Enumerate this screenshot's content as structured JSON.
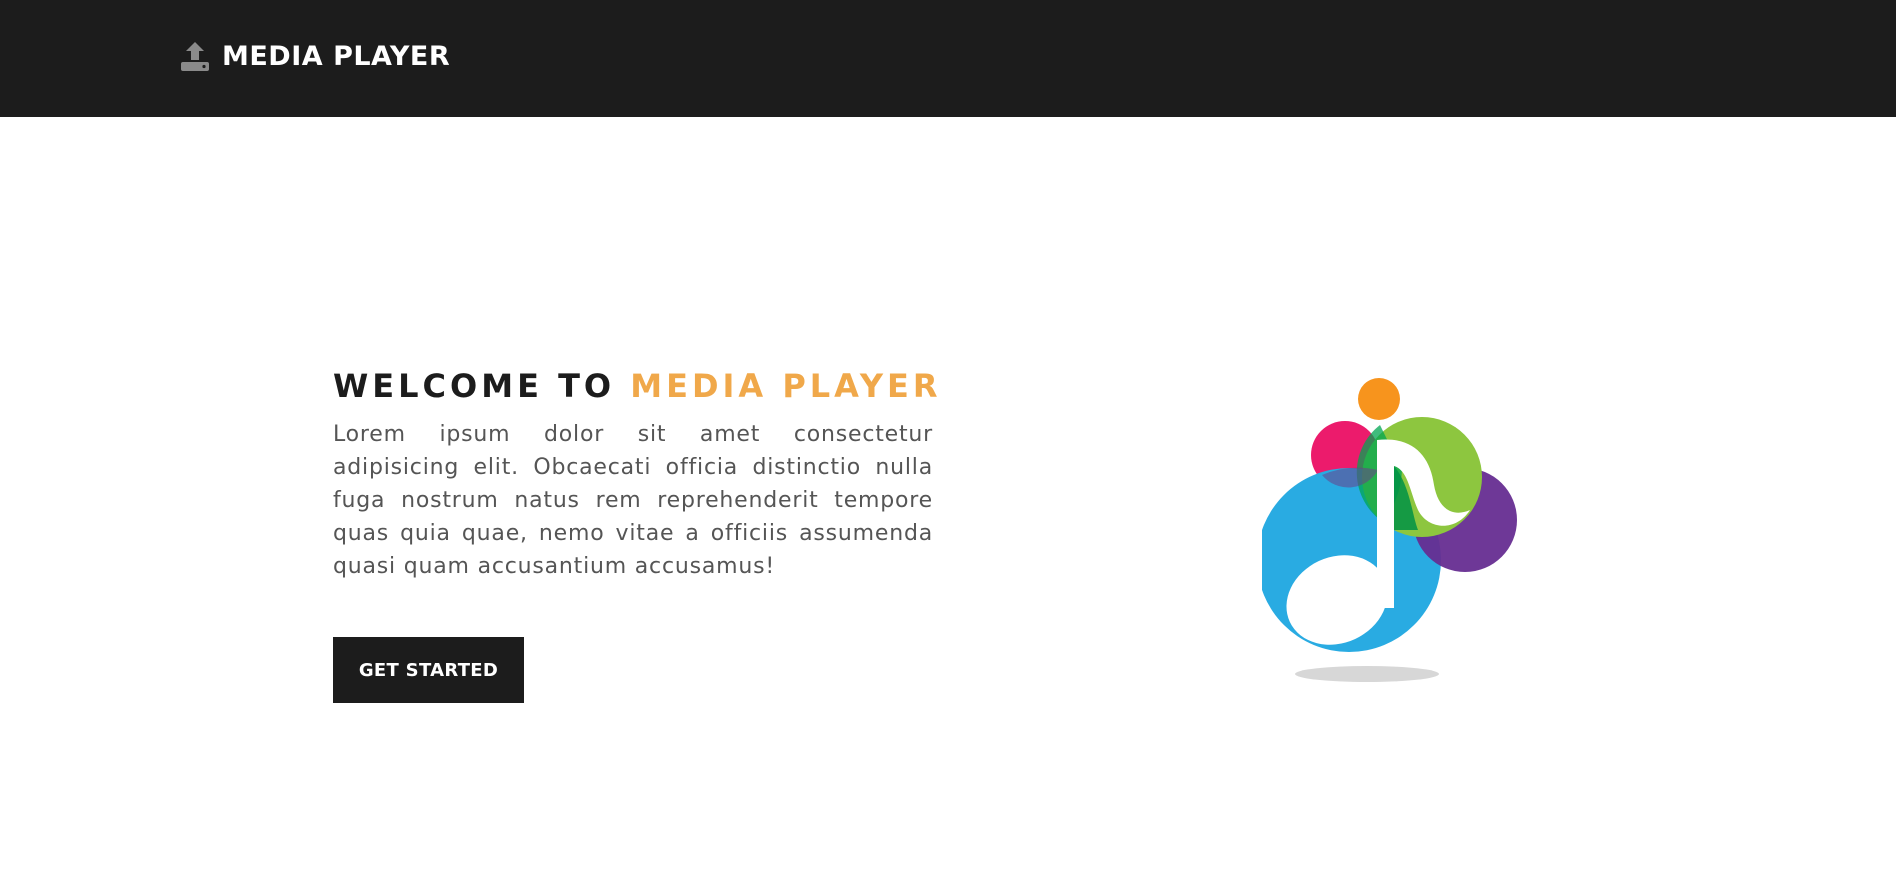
{
  "navbar": {
    "brand_icon": "upload-icon",
    "brand_text": "MEDIA PLAYER"
  },
  "hero": {
    "title_prefix": "WELCOME TO",
    "title_accent": "MEDIA PLAYER",
    "description": "Lorem ipsum dolor sit amet consectetur adipisicing elit. Obcaecati officia distinctio nulla fuga nostrum natus rem reprehenderit tempore quas quia quae, nemo vitae a officiis assumenda quasi quam accusantium accusamus!",
    "cta_label": "GET STARTED",
    "logo_icon": "music-note-icon"
  },
  "colors": {
    "navbar_bg": "#1c1c1c",
    "accent": "#f0a84a",
    "button_bg": "#1c1c1c",
    "logo_blue": "#29abe2",
    "logo_green": "#8dc63f",
    "logo_magenta": "#ec1b6c",
    "logo_purple": "#662d91",
    "logo_orange": "#f7941d"
  }
}
